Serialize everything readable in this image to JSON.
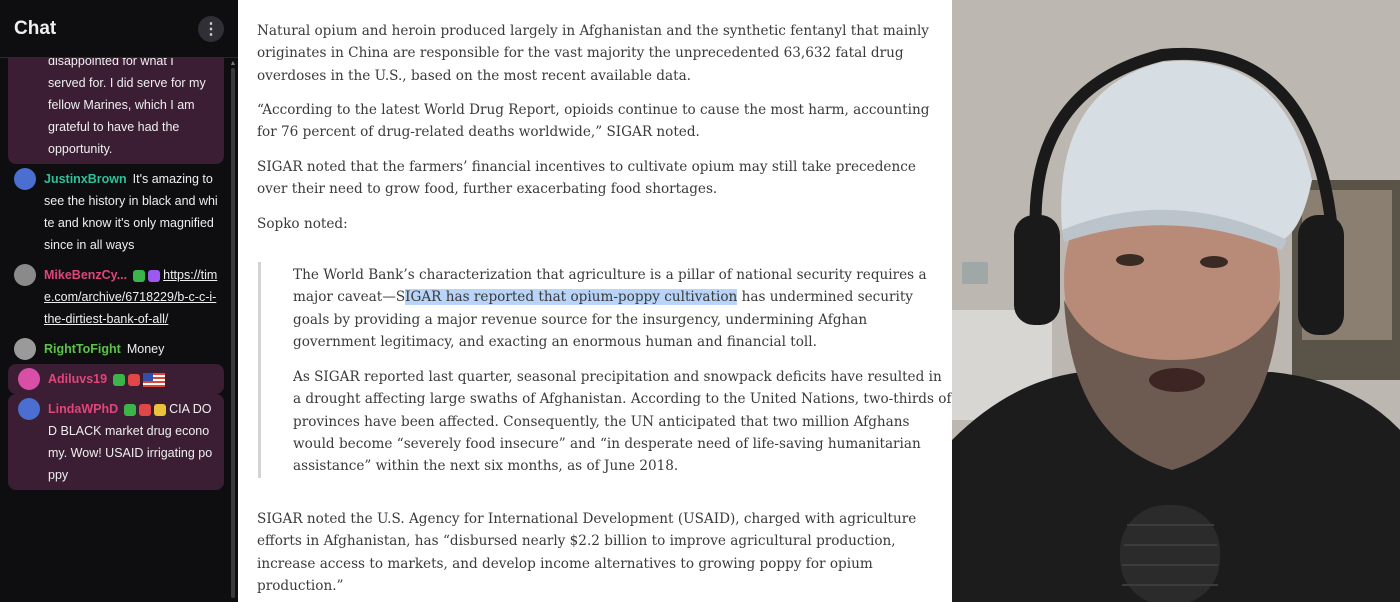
{
  "chat": {
    "title": "Chat",
    "menu_icon": "kebab-menu-icon",
    "messages": [
      {
        "type": "continuation",
        "highlight": true,
        "text": "disappointed for what I served for. I did serve for my fellow Marines, which I am grateful to have had the opportunity."
      },
      {
        "user": "JustinxBrown",
        "color": "#2fbf9b",
        "avatar_color": "#4a6fd1",
        "text": "It's amazing to see the history in black and white and know it's only magnified since in all ways"
      },
      {
        "user": "MikeBenzCy...",
        "color": "#e0457b",
        "avatar_color": "#8a8a8a",
        "badges": [
          "#3bb54a",
          "#9b59f2"
        ],
        "text": "https://time.com/archive/6718229/b-c-c-i-the-dirtiest-bank-of-all/"
      },
      {
        "user": "RightToFight",
        "color": "#5cc24a",
        "avatar_color": "#9a9a9a",
        "text": "Money"
      },
      {
        "user": "Adiluvs19",
        "color": "#e0457b",
        "avatar_color": "#d94fa8",
        "highlight": true,
        "badges": [
          "#3bb54a",
          "#e04848"
        ],
        "flag": true,
        "text": ""
      },
      {
        "user": "LindaWPhD",
        "color": "#e0457b",
        "avatar_color": "#4a6fd1",
        "highlight": true,
        "badges": [
          "#3bb54a",
          "#e04848",
          "#e8c23a"
        ],
        "text": "CIA DOD BLACK market drug economy. Wow! USAID irrigating poppy"
      }
    ]
  },
  "article": {
    "paragraphs": [
      "Natural opium and heroin produced largely in Afghanistan and the synthetic fentanyl that mainly originates in China are responsible for the vast majority the unprecedented 63,632 fatal drug overdoses in the U.S., based on the most recent available data.",
      "“According to the latest World Drug Report, opioids continue to cause the most harm, accounting for 76 percent of drug-related deaths worldwide,” SIGAR noted.",
      "SIGAR noted that the farmers’ financial incentives to cultivate opium may still take precedence over their need to grow food, further exacerbating food shortages.",
      "Sopko noted:"
    ],
    "quote_1_before": "The World Bank’s characterization that agriculture is a pillar of national security requires a major caveat—S",
    "quote_1_selected": "IGAR has reported that opium-poppy cultivation",
    "quote_1_after": " has undermined security goals by providing a major revenue source for the insurgency, undermining Afghan government legitimacy, and exacting an enormous human and financial toll.",
    "quote_2": "As SIGAR reported last quarter, seasonal precipitation and snowpack deficits have resulted in a drought affecting large swaths of Afghanistan. According to the United Nations, two-thirds of provinces have been affected. Consequently, the UN anticipated that two million Afghans would become “severely food insecure” and “in desperate need of life-saving humanitarian assistance” within the next six months, as of June 2018.",
    "final_paragraph": "SIGAR noted the U.S. Agency for International Development (USAID), charged with agriculture efforts in Afghanistan, has “disbursed nearly $2.2 billion to improve agricultural production, increase access to markets, and develop income alternatives to growing poppy for opium production.”"
  },
  "webcam": {
    "icon": "webcam-feed-icon"
  }
}
